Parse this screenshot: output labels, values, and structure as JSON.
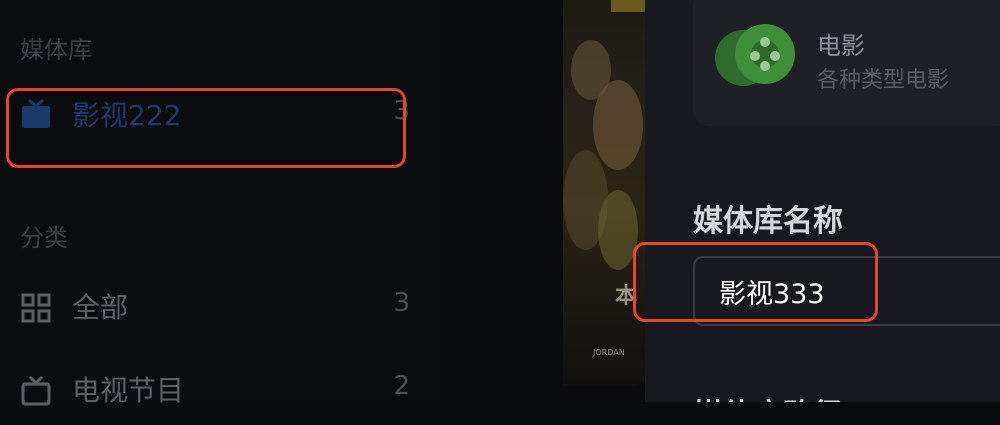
{
  "sidebar": {
    "library_section": "媒体库",
    "library_item": {
      "label": "影视222",
      "count": "3",
      "icon": "tv-icon"
    },
    "category_section": "分类",
    "categories": [
      {
        "label": "全部",
        "count": "3",
        "icon": "grid-icon"
      },
      {
        "label": "电视节目",
        "count": "2",
        "icon": "tv-outline-icon"
      }
    ]
  },
  "panel": {
    "type_card": {
      "title": "电影",
      "description": "各种类型电影",
      "icon": "film-reel-icon"
    },
    "name_field": {
      "label": "媒体库名称",
      "value": "影视333"
    },
    "next_label": "媒体库路径"
  },
  "poster": {
    "caption": "JORDAN"
  },
  "colors": {
    "highlight": "#e8452c",
    "accent_blue": "#1b3a6b",
    "film_green": "#3f8f3a"
  }
}
